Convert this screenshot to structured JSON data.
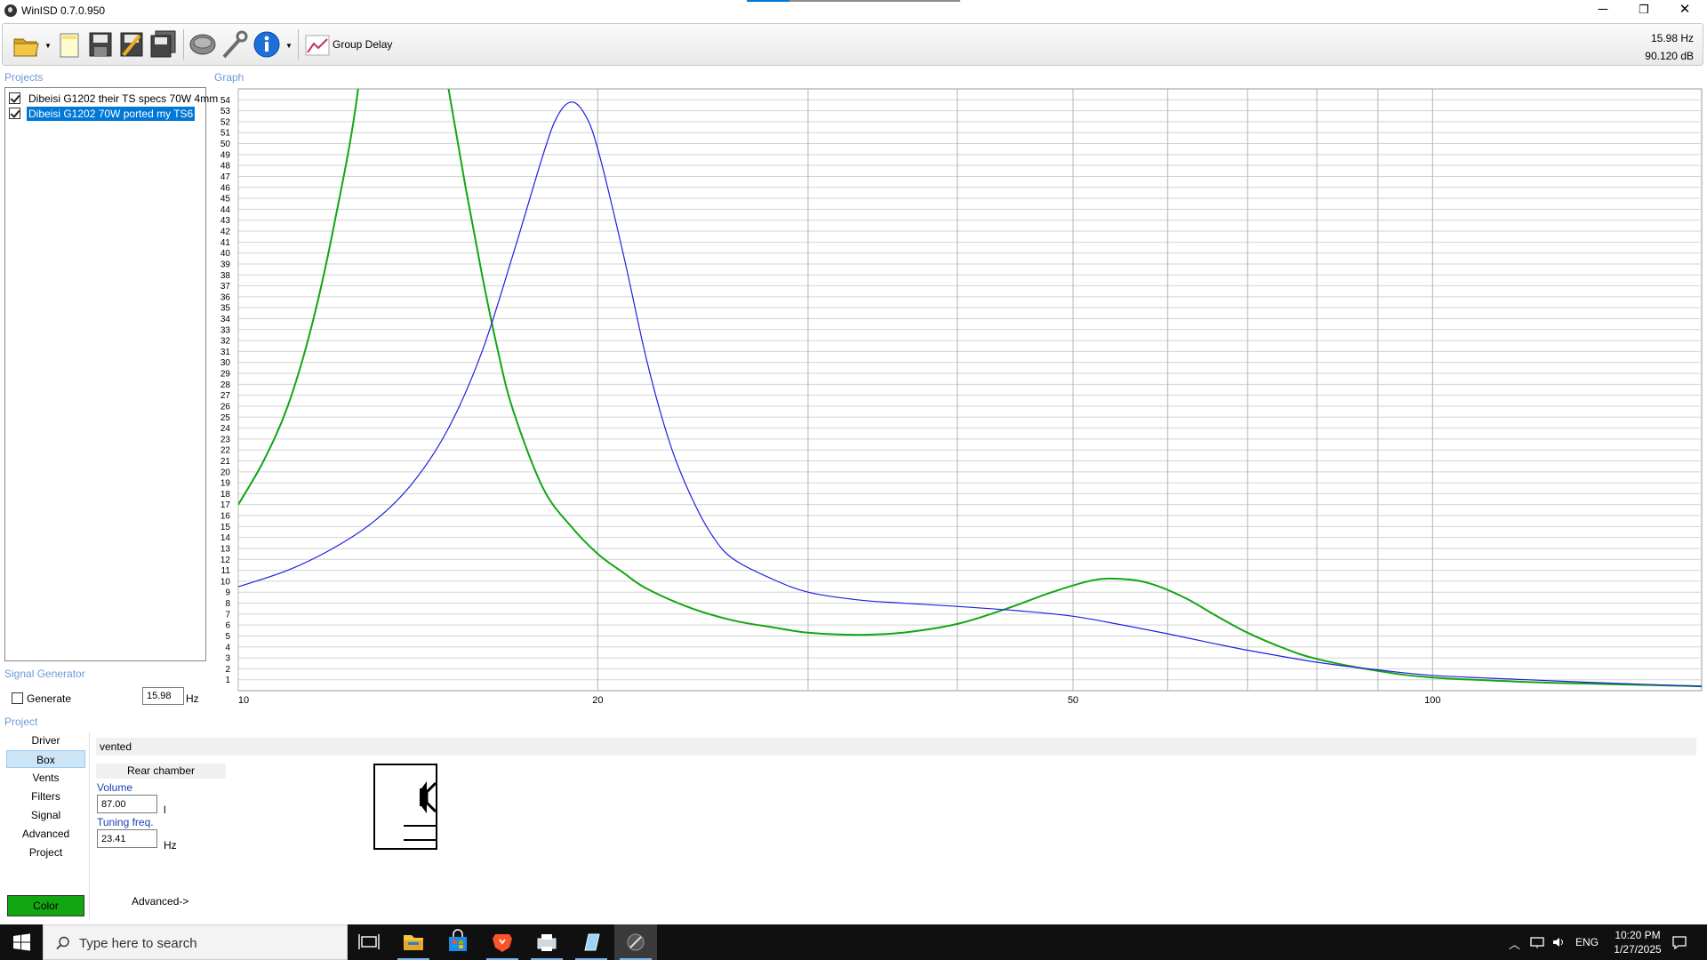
{
  "window": {
    "title": "WinISD 0.7.0.950",
    "controls": {
      "minimize": "─",
      "restore": "❐",
      "close": "✕"
    }
  },
  "toolbar": {
    "buttons": [
      {
        "name": "open-folder-icon"
      },
      {
        "name": "new-document-icon"
      },
      {
        "name": "save-icon"
      },
      {
        "name": "save-as-icon"
      },
      {
        "name": "save-all-icon"
      },
      {
        "name": "driver-editor-icon"
      },
      {
        "name": "tools-icon"
      },
      {
        "name": "info-icon"
      }
    ],
    "graph_button_label": "Group Delay",
    "readout_freq": "15.98 Hz",
    "readout_level": "90.120 dB"
  },
  "sections": {
    "projects": "Projects",
    "graph": "Graph",
    "signal_generator": "Signal Generator",
    "project": "Project"
  },
  "projects": [
    {
      "label": "Dibeisi G1202 their TS specs 70W 4mm",
      "checked": true,
      "selected": false,
      "color": "#13a613"
    },
    {
      "label": "Dibeisi G1202 70W ported my TS6",
      "checked": true,
      "selected": true,
      "color": "#2020e0"
    }
  ],
  "signal_generator": {
    "generate_label": "Generate",
    "generate_checked": false,
    "frequency": "15.98",
    "unit": "Hz"
  },
  "project_nav": {
    "items": [
      "Driver",
      "Box",
      "Vents",
      "Filters",
      "Signal",
      "Advanced",
      "Project"
    ],
    "active": "Box",
    "color_button": "Color",
    "color_value": "#13a613"
  },
  "box": {
    "type": "vented",
    "chamber_label": "Rear chamber",
    "volume_label": "Volume",
    "volume_value": "87.00",
    "volume_unit": "l",
    "tuning_label": "Tuning freq.",
    "tuning_value": "23.41",
    "tuning_unit": "Hz",
    "advanced_link": "Advanced->"
  },
  "chart_data": {
    "type": "line",
    "title": "",
    "xlabel": "",
    "ylabel": "",
    "xscale": "log",
    "xlim": [
      10,
      168
    ],
    "ylim": [
      0,
      55
    ],
    "x_tick_labels": [
      "10",
      "20",
      "50",
      "100"
    ],
    "y_tick_labels": [
      "1",
      "2",
      "3",
      "4",
      "5",
      "6",
      "7",
      "8",
      "9",
      "10",
      "11",
      "12",
      "13",
      "14",
      "15",
      "16",
      "17",
      "18",
      "19",
      "20",
      "21",
      "22",
      "23",
      "24",
      "25",
      "26",
      "27",
      "28",
      "29",
      "30",
      "31",
      "32",
      "33",
      "34",
      "35",
      "36",
      "37",
      "38",
      "39",
      "40",
      "41",
      "42",
      "43",
      "44",
      "45",
      "46",
      "47",
      "48",
      "49",
      "50",
      "51",
      "52",
      "53",
      "54"
    ],
    "grid": true,
    "series": [
      {
        "color": "#13a613",
        "x": [
          10,
          10.5,
          11,
          11.5,
          12,
          12.6,
          13,
          13.5,
          14,
          14.5,
          15,
          15.5,
          16,
          16.5,
          17,
          18,
          19,
          20,
          21,
          22,
          24,
          26,
          28,
          30,
          33,
          36,
          40,
          44,
          48,
          52,
          55,
          58,
          62,
          66,
          70,
          75,
          80,
          90,
          100,
          120,
          140,
          168
        ],
        "y": [
          17,
          21,
          26,
          33,
          42,
          55,
          72,
          80,
          80,
          65,
          55,
          46,
          38,
          31,
          25.5,
          18.5,
          15,
          12.5,
          10.8,
          9.3,
          7.5,
          6.4,
          5.8,
          5.3,
          5.1,
          5.3,
          6.1,
          7.5,
          9,
          10.1,
          10.2,
          9.8,
          8.5,
          6.8,
          5.3,
          3.9,
          2.9,
          1.8,
          1.2,
          0.8,
          0.6,
          0.4
        ]
      },
      {
        "color": "#2020e0",
        "x": [
          10,
          11,
          12,
          13,
          14,
          15,
          16,
          17,
          18,
          18.5,
          19,
          19.5,
          20,
          21,
          22,
          23,
          24,
          25,
          26,
          28,
          30,
          33,
          36,
          40,
          45,
          50,
          55,
          60,
          65,
          70,
          80,
          90,
          100,
          120,
          140,
          168
        ],
        "y": [
          9.5,
          11,
          13,
          15.5,
          19,
          24,
          31,
          40,
          49,
          52.5,
          53.8,
          52.7,
          49.5,
          40,
          30,
          22.5,
          17.5,
          14,
          12,
          10.2,
          9,
          8.3,
          8,
          7.7,
          7.3,
          6.8,
          6,
          5.2,
          4.4,
          3.7,
          2.6,
          1.9,
          1.4,
          1,
          0.7,
          0.4
        ]
      }
    ]
  },
  "taskbar": {
    "search_placeholder": "Type here to search",
    "language": "ENG",
    "time": "10:20 PM",
    "date": "1/27/2025",
    "apps": [
      "task-view-icon",
      "file-explorer-icon",
      "store-icon",
      "brave-icon",
      "printer-app-icon",
      "notepad-app-icon",
      "winisd-app-icon"
    ]
  }
}
